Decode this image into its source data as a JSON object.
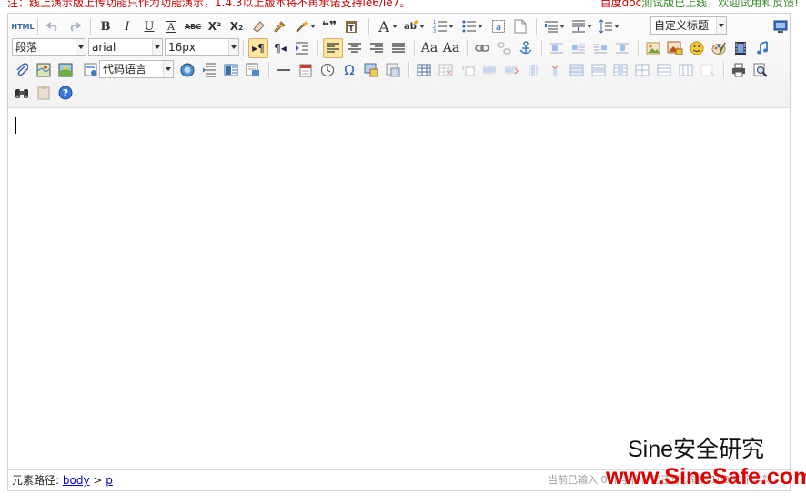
{
  "notice": {
    "left": "注：线上演示版上传功能只作为功能演示，1.4.3以上版本将不再承诺支持ie6/ie7。",
    "right_red": "百度doc",
    "right_green": "测试版已上线，欢迎试用和反馈!"
  },
  "toolbar": {
    "html_label": "HTML",
    "paragraph_select": "段落",
    "font_family_select": "arial",
    "font_size_select": "16px",
    "custom_title_select": "自定义标题",
    "code_language_select": "代码语言",
    "bold": "B",
    "italic": "I",
    "underline": "U",
    "fontborder": "A",
    "strikethrough": "ABC",
    "superscript": "X²",
    "subscript": "X₂",
    "blockquote": "❝❞",
    "omega": "Ω"
  },
  "status": {
    "path_label": "元素路径:",
    "path_body": "body",
    "path_sep": ">",
    "path_p": "p",
    "wordcount": "当前已输入 0 个字符，您还可以输入10000个字符。"
  },
  "watermark": {
    "line1": "Sine安全研究",
    "line2": "www.SineSafe.com"
  },
  "colors": {
    "accent_active": "#ffe69f",
    "notice_red": "#cc0000",
    "notice_green": "#3a8a2a",
    "watermark_red": "#e00000"
  }
}
